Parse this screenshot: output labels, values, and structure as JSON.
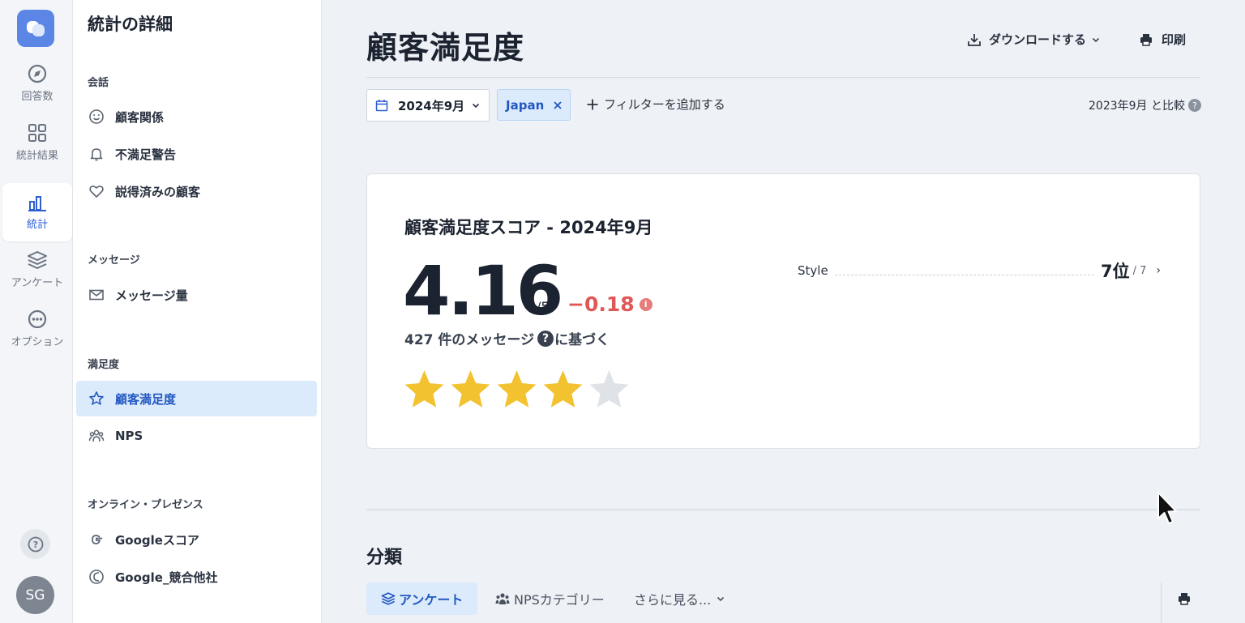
{
  "rail": {
    "items": [
      {
        "label": "回答数",
        "icon": "compass-icon"
      },
      {
        "label": "統計結果",
        "icon": "grid-icon"
      },
      {
        "label": "統計",
        "icon": "bar-chart-icon"
      },
      {
        "label": "アンケート",
        "icon": "layers-icon"
      },
      {
        "label": "オプション",
        "icon": "more-icon"
      }
    ],
    "avatar": "SG"
  },
  "subnav": {
    "title": "統計の詳細",
    "sections": [
      {
        "label": "会話",
        "items": [
          "顧客関係",
          "不満足警告",
          "説得済みの顧客"
        ]
      },
      {
        "label": "メッセージ",
        "items": [
          "メッセージ量"
        ]
      },
      {
        "label": "満足度",
        "items": [
          "顧客満足度",
          "NPS"
        ]
      },
      {
        "label": "オンライン・プレゼンス",
        "items": [
          "Googleスコア",
          "Google_競合他社"
        ]
      }
    ]
  },
  "header": {
    "title": "顧客満足度",
    "download_label": "ダウンロードする",
    "print_label": "印刷"
  },
  "filters": {
    "date": "2024年9月",
    "chip": "Japan",
    "add_filter": "フィルターを追加する",
    "compare": "2023年9月 と比較"
  },
  "card": {
    "title": "顧客満足度スコア - 2024年9月",
    "score": "4.16",
    "score_max": "/5",
    "delta": "−0.18",
    "based_count": "427 件のメッセージ",
    "based_suffix": "に基づく",
    "rating_stars": 4,
    "rating_total": 5,
    "rank": {
      "label": "Style",
      "value": "7位",
      "of": "/ 7"
    }
  },
  "breakdown": {
    "title": "分類",
    "tabs": [
      "アンケート",
      "NPSカテゴリー",
      "さらに見る..."
    ]
  },
  "colors": {
    "accent": "#2258c2",
    "star": "#f2c230",
    "negative": "#e05757"
  }
}
